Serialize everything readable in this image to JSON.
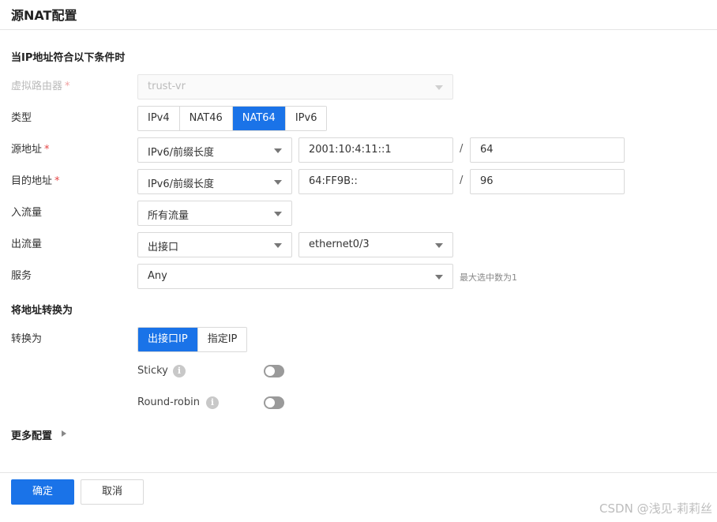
{
  "dialog": {
    "title": "源NAT配置"
  },
  "section_match": {
    "title": "当IP地址符合以下条件时"
  },
  "virtual_router": {
    "label": "虚拟路由器",
    "required_mark": "*",
    "value": "trust-vr"
  },
  "type": {
    "label": "类型",
    "options": [
      "IPv4",
      "NAT46",
      "NAT64",
      "IPv6"
    ],
    "selected": "NAT64"
  },
  "source": {
    "label": "源地址",
    "required_mark": "*",
    "mode": "IPv6/前缀长度",
    "address": "2001:10:4:11::1",
    "separator": "/",
    "prefix": "64"
  },
  "destination": {
    "label": "目的地址",
    "required_mark": "*",
    "mode": "IPv6/前缀长度",
    "address": "64:FF9B::",
    "separator": "/",
    "prefix": "96"
  },
  "ingress": {
    "label": "入流量",
    "value": "所有流量"
  },
  "egress": {
    "label": "出流量",
    "value": "出接口",
    "interface": "ethernet0/3"
  },
  "service": {
    "label": "服务",
    "value": "Any",
    "hint": "最大选中数为1"
  },
  "section_translate": {
    "title": "将地址转换为"
  },
  "translate_to": {
    "label": "转换为",
    "options": [
      "出接口IP",
      "指定IP"
    ],
    "selected": "出接口IP"
  },
  "sticky": {
    "label": "Sticky",
    "info_icon": "info-icon",
    "enabled": false
  },
  "round_robin": {
    "label": "Round-robin",
    "info_icon": "info-icon",
    "enabled": false
  },
  "more": {
    "label": "更多配置"
  },
  "footer": {
    "ok_label": "确定",
    "cancel_label": "取消"
  },
  "watermark": {
    "text": "CSDN @浅见-莉莉丝"
  },
  "colors": {
    "accent": "#1a73e8",
    "required": "#e54545"
  }
}
